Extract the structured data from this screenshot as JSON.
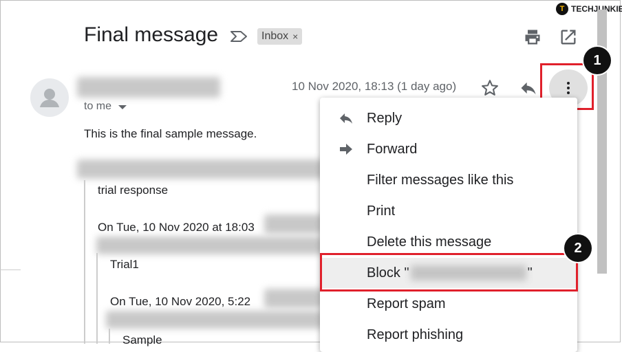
{
  "brand": {
    "logo_text": "TECHJUNKIE",
    "logo_letter": "T"
  },
  "header": {
    "subject": "Final message",
    "label_chip": "Inbox",
    "chip_remove": "×",
    "print_icon": "print-icon",
    "open_new_window_icon": "open-in-new-window-icon"
  },
  "message": {
    "sender_name": "[sender name blurred]",
    "date": "10 Nov 2020, 18:13 (1 day ago)",
    "to": "to me",
    "body": "This is the final sample message."
  },
  "quoted": {
    "line1": "trial response",
    "line2": "On Tue, 10 Nov 2020 at 18:03",
    "line3": "Trial1",
    "line4": "On Tue, 10 Nov 2020, 5:22",
    "line5": "Sample"
  },
  "menu": {
    "items": [
      {
        "label": "Reply",
        "icon": "reply-icon"
      },
      {
        "label": "Forward",
        "icon": "forward-icon"
      },
      {
        "label": "Filter messages like this"
      },
      {
        "label": "Print"
      },
      {
        "label": "Delete this message"
      },
      {
        "label": "Block \"",
        "suffix": "\""
      },
      {
        "label": "Report spam"
      },
      {
        "label": "Report phishing"
      }
    ]
  },
  "annotations": {
    "step1": "1",
    "step2": "2"
  },
  "colors": {
    "highlight_red": "#e0202b",
    "menu_hover": "#eeeeee"
  }
}
